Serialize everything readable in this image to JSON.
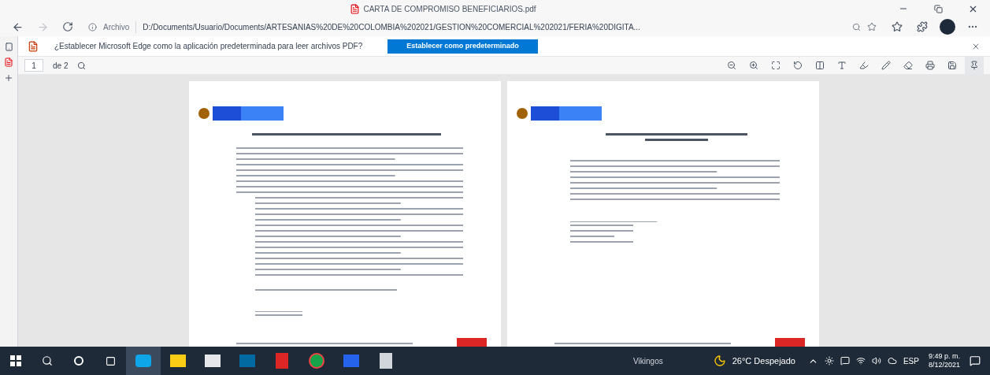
{
  "window": {
    "title": "CARTA DE COMPROMISO BENEFICIARIOS.pdf"
  },
  "address_bar": {
    "scheme": "Archivo",
    "url": "D:/Documents/Usuario/Documents/ARTESANIAS%20DE%20COLOMBIA%202021/GESTION%20COMERCIAL%202021/FERIA%20DIGITA..."
  },
  "banner": {
    "message": "¿Establecer Microsoft Edge como la aplicación predeterminada para leer archivos PDF?",
    "button": "Establecer como predeterminado"
  },
  "pdf_toolbar": {
    "page": "1",
    "page_count": "de 2"
  },
  "pages": [
    {
      "kind": "list"
    },
    {
      "kind": "form"
    }
  ],
  "taskbar": {
    "search_text": "Vikingos",
    "weather": "26°C Despejado",
    "language": "ESP",
    "time": "9:49 p. m.",
    "date": "8/12/2021"
  }
}
